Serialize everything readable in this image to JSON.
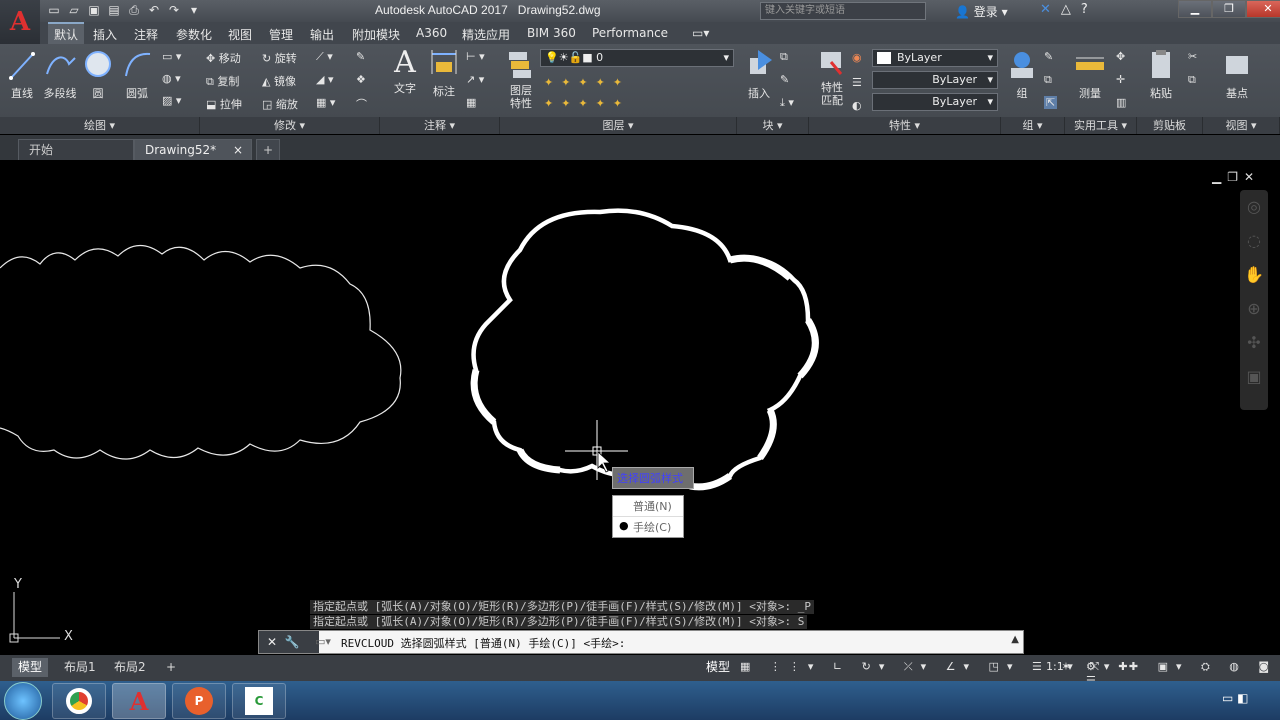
{
  "title": {
    "app": "Autodesk AutoCAD 2017",
    "doc": "Drawing52.dwg"
  },
  "search": {
    "placeholder": "键入关键字或短语"
  },
  "login_label": "登录",
  "menu": [
    "默认",
    "插入",
    "注释",
    "参数化",
    "视图",
    "管理",
    "输出",
    "附加模块",
    "A360",
    "精选应用",
    "BIM 360",
    "Performance"
  ],
  "ribbon": {
    "draw": {
      "line": "直线",
      "polyline": "多段线",
      "circle": "圆",
      "arc": "圆弧",
      "title": "绘图"
    },
    "modify": {
      "move": "移动",
      "rotate": "旋转",
      "copy": "复制",
      "mirror": "镜像",
      "stretch": "拉伸",
      "scale": "缩放",
      "title": "修改"
    },
    "annotation": {
      "text": "文字",
      "dimension": "标注",
      "title": "注释"
    },
    "layers": {
      "props": "图层\n特性",
      "current": "0",
      "title": "图层"
    },
    "block": {
      "insert": "插入",
      "title": "块"
    },
    "properties": {
      "match": "特性\n匹配",
      "color": "ByLayer",
      "linetype": "ByLayer",
      "lineweight": "ByLayer",
      "title": "特性"
    },
    "groups": {
      "group": "组",
      "title": "组"
    },
    "utilities": {
      "measure": "测量",
      "title": "实用工具"
    },
    "clipboard": {
      "paste": "粘贴",
      "title": "剪贴板"
    },
    "view": {
      "base": "基点",
      "title": "视图"
    }
  },
  "filetabs": {
    "start": "开始",
    "drawing": "Drawing52*"
  },
  "popup": {
    "title": "选择圆弧样式",
    "options": [
      "普通(N)",
      "手绘(C)"
    ],
    "selected": 1
  },
  "cmd_history": [
    "指定起点或 [弧长(A)/对象(O)/矩形(R)/多边形(P)/徒手画(F)/样式(S)/修改(M)] <对象>: _P",
    "指定起点或 [弧长(A)/对象(O)/矩形(R)/多边形(P)/徒手画(F)/样式(S)/修改(M)] <对象>: S"
  ],
  "cmd_line": "REVCLOUD 选择圆弧样式 [普通(N) 手绘(C)] <手绘>:",
  "layout_tabs": [
    "模型",
    "布局1",
    "布局2"
  ],
  "status": {
    "model": "模型",
    "scale": "1:1"
  },
  "ucs": {
    "x": "X",
    "y": "Y"
  }
}
